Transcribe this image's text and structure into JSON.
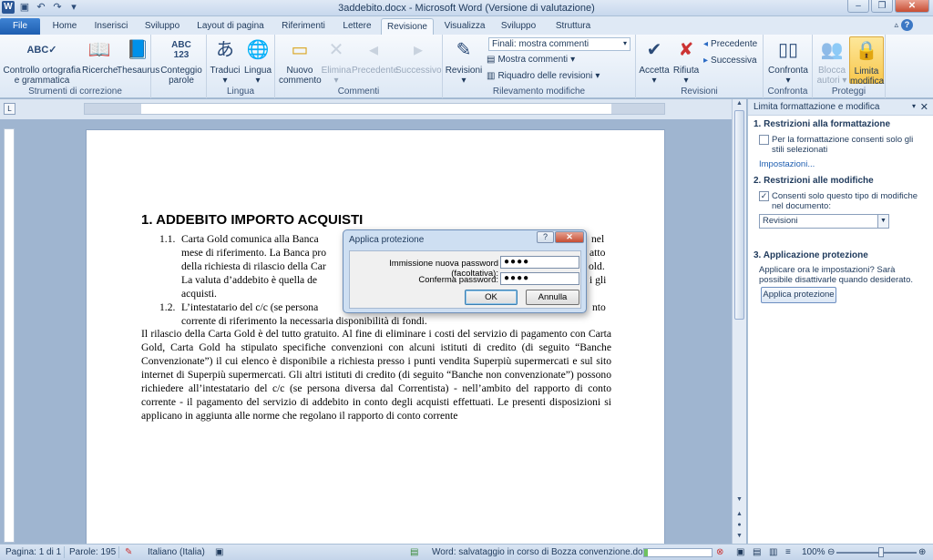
{
  "window": {
    "title": "3addebito.docx - Microsoft Word (Versione di valutazione)",
    "app_icon": "W"
  },
  "tabs": [
    "File",
    "Home",
    "Inserisci",
    "Sviluppo",
    "Layout di pagina",
    "Riferimenti",
    "Lettere",
    "Revisione",
    "Visualizza",
    "Sviluppo",
    "Struttura"
  ],
  "ribbon": {
    "groups": {
      "correction": "Strumenti di correzione",
      "language": "Lingua",
      "comments": "Commenti",
      "tracking": "Rilevamento modifiche",
      "changes": "Revisioni",
      "compare": "Confronta",
      "protect": "Proteggi"
    },
    "buttons": {
      "spelling": "Controllo ortografia e grammatica",
      "research": "Ricerche",
      "thesaurus": "Thesaurus",
      "word_count_1": "Conteggio",
      "word_count_2": "parole",
      "translate": "Traduci",
      "language": "Lingua",
      "new_comment_1": "Nuovo",
      "new_comment_2": "commento",
      "delete": "Elimina",
      "previous": "Precedente",
      "next": "Successivo",
      "revisions": "Revisioni",
      "final_mode": "Finali: mostra commenti",
      "show_comments": "Mostra commenti",
      "review_pane": "Riquadro delle revisioni",
      "accept": "Accetta",
      "reject": "Rifiuta",
      "prev_change": "Precedente",
      "next_change": "Successiva",
      "compare": "Confronta",
      "block_authors_1": "Blocca",
      "block_authors_2": "autori",
      "restrict_editing_1": "Limita",
      "restrict_editing_2": "modifica"
    }
  },
  "document": {
    "heading": "1. ADDEBITO IMPORTO ACQUISTI",
    "item_1_num": "1.1.",
    "item_1_lines": [
      "Carta Gold comunica alla Banca",
      "mese di riferimento. La Banca pro",
      "della richiesta di rilascio della Car",
      "La valuta d’addebito è quella de",
      "acquisti."
    ],
    "item_1_right": [
      "nel",
      "atto",
      "old.",
      "i gli"
    ],
    "item_2_num": "1.2.",
    "item_2_lines": [
      "L’intestatario del c/c (se persona",
      "corrente di riferimento la necessaria disponibilità di fondi."
    ],
    "item_2_right": "nto",
    "paragraph": "Il rilascio della Carta Gold è del tutto gratuito. Al fine di eliminare i costi del servizio di pagamento con Carta Gold, Carta Gold ha stipulato specifiche convenzioni con alcuni istituti di credito (di seguito “Banche Convenzionate”) il cui elenco è disponibile a richiesta presso i punti vendita Superpiù supermercati e sul sito internet di Superpiù supermercati. Gli altri istituti di credito (di seguito “Banche non convenzionate”) possono richiedere all’intestatario del c/c (se persona diversa dal Correntista) - nell’ambito del rapporto di conto corrente - il pagamento del servizio di addebito in conto degli acquisti effettuati. Le presenti disposizioni si applicano in aggiunta alle norme che regolano il rapporto di conto corrente"
  },
  "dialog": {
    "title": "Applica protezione",
    "new_password_label": "Immissione nuova password (facoltativa):",
    "new_password_value": "●●●●",
    "confirm_label": "Conferma password:",
    "confirm_value": "●●●●",
    "ok": "OK",
    "cancel": "Annulla"
  },
  "pane": {
    "title": "Limita formattazione e modifica",
    "sec1": "1. Restrizioni alla formattazione",
    "sec1_check": "Per la formattazione consenti solo gli stili selezionati",
    "sec1_checked": false,
    "settings_link": "Impostazioni...",
    "sec2": "2. Restrizioni alle modifiche",
    "sec2_check": "Consenti solo questo tipo di modifiche nel documento:",
    "sec2_checked": true,
    "edit_type": "Revisioni",
    "sec3": "3. Applicazione protezione",
    "sec3_text": "Applicare ora le impostazioni? Sarà possibile disattivarle quando desiderato.",
    "apply_button": "Applica protezione"
  },
  "status": {
    "page": "Pagina: 1 di 1",
    "words": "Parole: 195",
    "language": "Italiano (Italia)",
    "saving": "Word: salvataggio in corso di Bozza convenzione.docx:",
    "progress": 0.05,
    "zoom": "100%"
  },
  "colors": {
    "ribbon_bg": "#dde8f5",
    "file_tab": "#2b6bc4",
    "doc_bg": "#9fb5d0",
    "highlight": "#f8c74c"
  }
}
